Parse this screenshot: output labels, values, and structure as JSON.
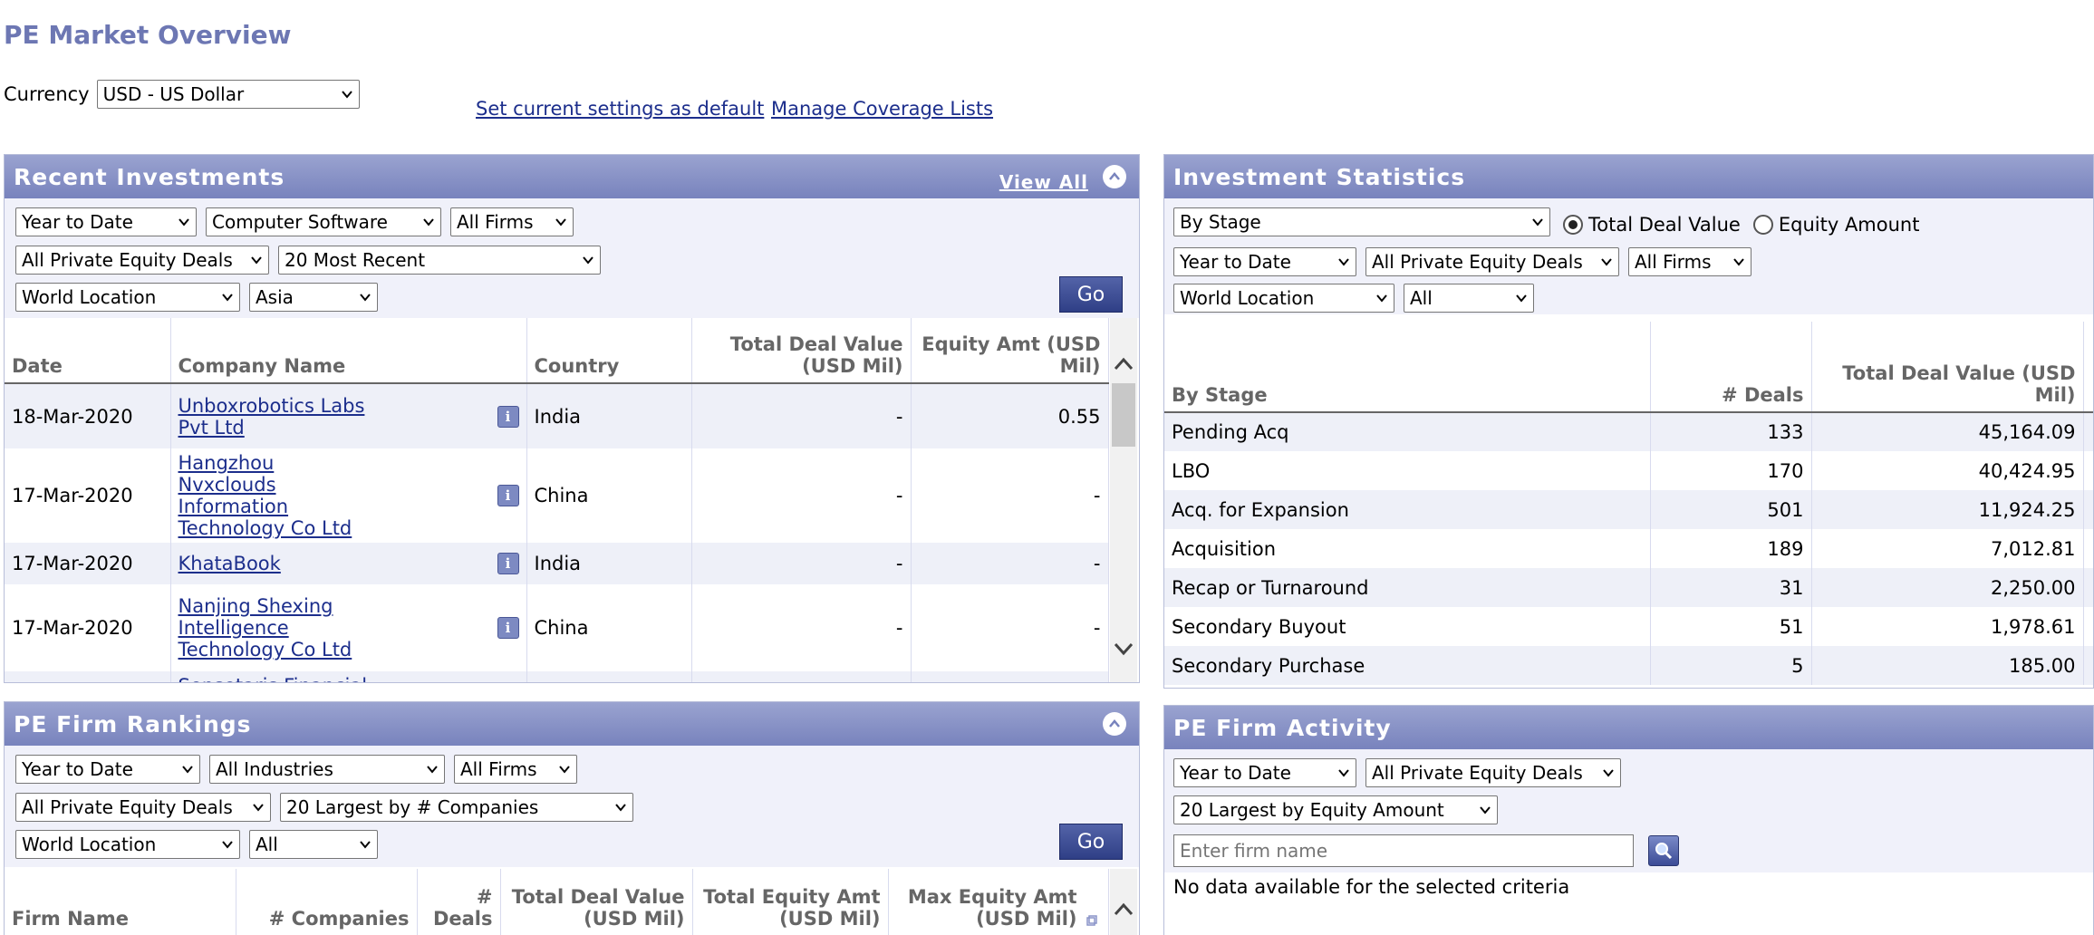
{
  "page": {
    "title": "PE Market Overview",
    "currency_label": "Currency",
    "currency_value": "USD - US Dollar",
    "set_default_link": "Set current settings as default",
    "manage_coverage_link": "Manage Coverage Lists"
  },
  "colors": {
    "title": "#6d77b3",
    "panel_header": "#7883bd",
    "filter_bg": "#f0f1fa",
    "link": "#1c2e8c",
    "go_button": "#2f3f86"
  },
  "recent_investments": {
    "title": "Recent Investments",
    "view_all": "View All",
    "filters": {
      "period": "Year to Date",
      "industry": "Computer Software",
      "firms": "All Firms",
      "deal_type": "All Private Equity Deals",
      "count": "20 Most Recent",
      "location_type": "World Location",
      "location": "Asia"
    },
    "go_label": "Go",
    "columns": [
      "Date",
      "Company Name",
      "Country",
      "Total Deal Value (USD Mil)",
      "Equity Amt (USD Mil)"
    ],
    "rows": [
      {
        "date": "18-Mar-2020",
        "company": "Unboxrobotics Labs Pvt Ltd",
        "country": "India",
        "deal_value": "-",
        "equity": "0.55"
      },
      {
        "date": "17-Mar-2020",
        "company": "Hangzhou Nvxclouds Information Technology Co Ltd",
        "country": "China",
        "deal_value": "-",
        "equity": "-"
      },
      {
        "date": "17-Mar-2020",
        "company": "KhataBook",
        "country": "India",
        "deal_value": "-",
        "equity": "-"
      },
      {
        "date": "17-Mar-2020",
        "company": "Nanjing Shexing Intelligence Technology Co Ltd",
        "country": "China",
        "deal_value": "-",
        "equity": "-"
      }
    ],
    "partial_row_text": "Sensetaris Financial"
  },
  "investment_statistics": {
    "title": "Investment Statistics",
    "filters": {
      "group_by": "By Stage",
      "radio_total": "Total Deal Value",
      "radio_equity": "Equity Amount",
      "period": "Year to Date",
      "deal_type": "All Private Equity Deals",
      "firms": "All Firms",
      "location_type": "World Location",
      "location": "All"
    },
    "columns": [
      "By Stage",
      "# Deals",
      "Total Deal Value (USD Mil)"
    ],
    "rows": [
      {
        "stage": "Pending Acq",
        "deals": "133",
        "value": "45,164.09"
      },
      {
        "stage": "LBO",
        "deals": "170",
        "value": "40,424.95"
      },
      {
        "stage": "Acq. for Expansion",
        "deals": "501",
        "value": "11,924.25"
      },
      {
        "stage": "Acquisition",
        "deals": "189",
        "value": "7,012.81"
      },
      {
        "stage": "Recap or Turnaround",
        "deals": "31",
        "value": "2,250.00"
      },
      {
        "stage": "Secondary Buyout",
        "deals": "51",
        "value": "1,978.61"
      },
      {
        "stage": "Secondary Purchase",
        "deals": "5",
        "value": "185.00"
      }
    ]
  },
  "pe_firm_rankings": {
    "title": "PE Firm Rankings",
    "filters": {
      "period": "Year to Date",
      "industry": "All Industries",
      "firms": "All Firms",
      "deal_type": "All Private Equity Deals",
      "count": "20 Largest by # Companies",
      "location_type": "World Location",
      "location": "All"
    },
    "go_label": "Go",
    "columns": [
      "Firm Name",
      "# Companies",
      "# Deals",
      "Total Deal Value (USD Mil)",
      "Total Equity Amt (USD Mil)",
      "Max Equity Amt (USD Mil)"
    ]
  },
  "pe_firm_activity": {
    "title": "PE Firm Activity",
    "filters": {
      "period": "Year to Date",
      "deal_type": "All Private Equity Deals",
      "count": "20 Largest by Equity Amount"
    },
    "firm_placeholder": "Enter firm name",
    "no_data": "No data available for the selected criteria"
  }
}
